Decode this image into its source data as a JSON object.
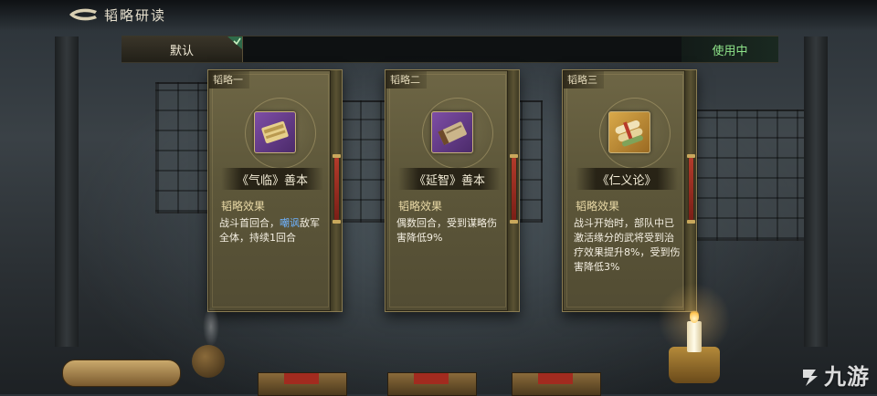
{
  "header": {
    "title": "韬略研读"
  },
  "tabs": {
    "default_label": "默认",
    "in_use_label": "使用中"
  },
  "cards": [
    {
      "tag": "韬略一",
      "name": "《气临》善本",
      "effect_label": "韬略效果",
      "effect_pre": "战斗首回合，",
      "effect_keyword": "嘲讽",
      "effect_post": "敌军全体，持续1回合",
      "icon": "purple-scroll-icon"
    },
    {
      "tag": "韬略二",
      "name": "《延智》善本",
      "effect_label": "韬略效果",
      "effect_pre": "偶数回合，受到谋略伤害降低9%",
      "effect_keyword": "",
      "effect_post": "",
      "icon": "purple-book-icon"
    },
    {
      "tag": "韬略三",
      "name": "《仁义论》",
      "effect_label": "韬略效果",
      "effect_pre": "战斗开始时，部队中已激活缘分的武将受到治疗效果提升8%，受到伤害降低3%",
      "effect_keyword": "",
      "effect_post": "",
      "icon": "gold-scrolls-icon"
    }
  ],
  "watermark": {
    "text": "九游"
  },
  "colors": {
    "keyword": "#6fb3ff",
    "in_use": "#8fe58a",
    "card_bg": "#5d573a"
  }
}
